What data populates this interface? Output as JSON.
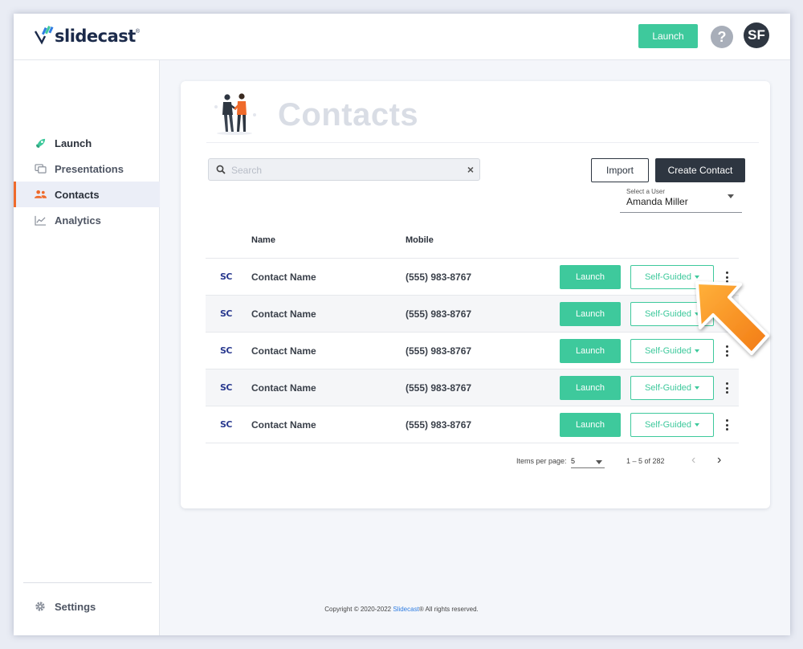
{
  "header": {
    "logo_text": "slidecast",
    "logo_tm": "®",
    "launch_label": "Launch",
    "help_label": "?",
    "avatar_initials": "SF"
  },
  "sidebar": {
    "items": [
      {
        "label": "Launch",
        "icon": "rocket-icon"
      },
      {
        "label": "Presentations",
        "icon": "slides-icon"
      },
      {
        "label": "Contacts",
        "icon": "people-icon",
        "active": true
      },
      {
        "label": "Analytics",
        "icon": "chart-icon"
      }
    ],
    "settings_label": "Settings"
  },
  "page": {
    "title": "Contacts",
    "search_placeholder": "Search",
    "search_value": "",
    "clear_label": "×",
    "import_label": "Import",
    "create_label": "Create Contact",
    "user_select_label": "Select a User",
    "user_select_value": "Amanda Miller"
  },
  "table": {
    "columns": [
      "Name",
      "Mobile"
    ],
    "rows": [
      {
        "logo": "SC",
        "name": "Contact Name",
        "mobile": "(555) 983-8767",
        "launch": "Launch",
        "mode": "Self-Guided"
      },
      {
        "logo": "SC",
        "name": "Contact Name",
        "mobile": "(555) 983-8767",
        "launch": "Launch",
        "mode": "Self-Guided"
      },
      {
        "logo": "SC",
        "name": "Contact Name",
        "mobile": "(555) 983-8767",
        "launch": "Launch",
        "mode": "Self-Guided"
      },
      {
        "logo": "SC",
        "name": "Contact Name",
        "mobile": "(555) 983-8767",
        "launch": "Launch",
        "mode": "Self-Guided"
      },
      {
        "logo": "SC",
        "name": "Contact Name",
        "mobile": "(555) 983-8767",
        "launch": "Launch",
        "mode": "Self-Guided"
      }
    ]
  },
  "pagination": {
    "items_label": "Items per page:",
    "items_value": "5",
    "range": "1 – 5 of 282"
  },
  "footer": {
    "prefix": "Copyright © 2020-2022",
    "brand": "Slidecast",
    "suffix": "® All rights reserved."
  },
  "colors": {
    "accent_green": "#3ec99c",
    "dark": "#2e3641",
    "active_orange": "#ef6a2b",
    "callout_arrow": "#f7941d"
  }
}
